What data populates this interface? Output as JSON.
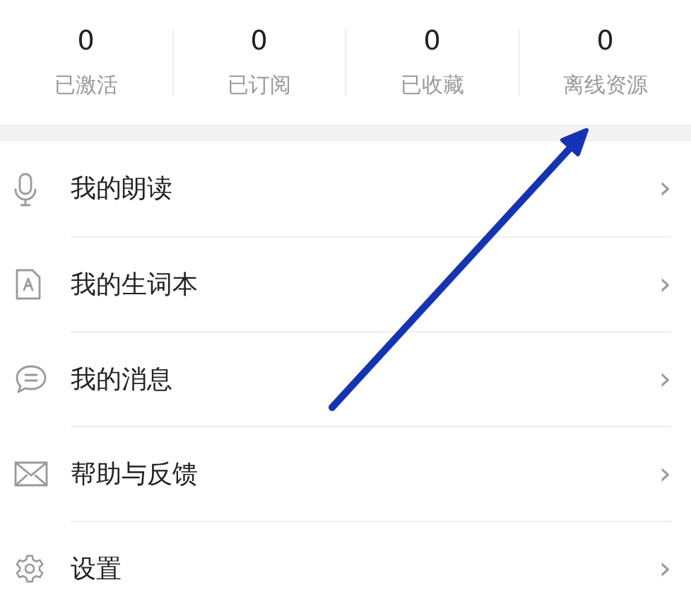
{
  "stats": [
    {
      "value": "0",
      "label": "已激活"
    },
    {
      "value": "0",
      "label": "已订阅"
    },
    {
      "value": "0",
      "label": "已收藏"
    },
    {
      "value": "0",
      "label": "离线资源"
    }
  ],
  "menu": [
    {
      "label": "我的朗读",
      "chevron": "›"
    },
    {
      "label": "我的生词本",
      "chevron": "›"
    },
    {
      "label": "我的消息",
      "chevron": "›"
    },
    {
      "label": "帮助与反馈",
      "chevron": "›"
    },
    {
      "label": "设置",
      "chevron": "›"
    }
  ]
}
